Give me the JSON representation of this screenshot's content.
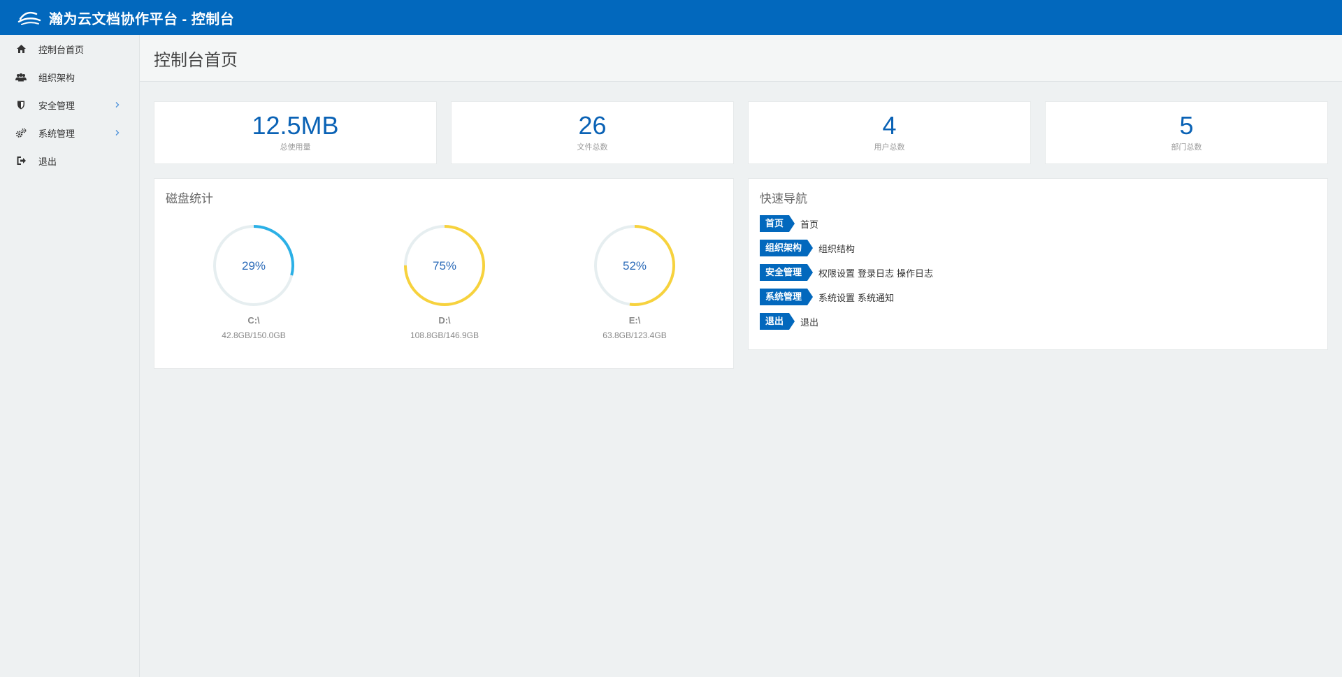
{
  "header": {
    "title": "瀚为云文档协作平台 - 控制台"
  },
  "sidebar": {
    "items": [
      {
        "label": "控制台首页",
        "icon": "home-icon"
      },
      {
        "label": "组织架构",
        "icon": "users-icon"
      },
      {
        "label": "安全管理",
        "icon": "shield-icon",
        "has_submenu": true
      },
      {
        "label": "系统管理",
        "icon": "gears-icon",
        "has_submenu": true
      },
      {
        "label": "退出",
        "icon": "sign-out-icon"
      }
    ]
  },
  "page": {
    "title": "控制台首页"
  },
  "stats": [
    {
      "value": "12.5MB",
      "label": "总使用量"
    },
    {
      "value": "26",
      "label": "文件总数"
    },
    {
      "value": "4",
      "label": "用户总数"
    },
    {
      "value": "5",
      "label": "部门总数"
    }
  ],
  "disk": {
    "title": "磁盘统计",
    "drives": [
      {
        "name": "C:\\",
        "percent_label": "29%",
        "percent": 29,
        "usage": "42.8GB/150.0GB",
        "color": "#2bb0e6"
      },
      {
        "name": "D:\\",
        "percent_label": "75%",
        "percent": 75,
        "usage": "108.8GB/146.9GB",
        "color": "#f7d23d"
      },
      {
        "name": "E:\\",
        "percent_label": "52%",
        "percent": 52,
        "usage": "63.8GB/123.4GB",
        "color": "#f7d23d"
      }
    ],
    "track_color": "#e6eef0"
  },
  "quicknav": {
    "title": "快速导航",
    "rows": [
      {
        "tag": "首页",
        "links": [
          "首页"
        ]
      },
      {
        "tag": "组织架构",
        "links": [
          "组织结构"
        ]
      },
      {
        "tag": "安全管理",
        "links": [
          "权限设置",
          "登录日志",
          "操作日志"
        ]
      },
      {
        "tag": "系统管理",
        "links": [
          "系统设置",
          "系统通知"
        ]
      },
      {
        "tag": "退出",
        "links": [
          "退出"
        ]
      }
    ]
  },
  "colors": {
    "brand": "#0268bd",
    "stat_value": "#0a62b5"
  }
}
